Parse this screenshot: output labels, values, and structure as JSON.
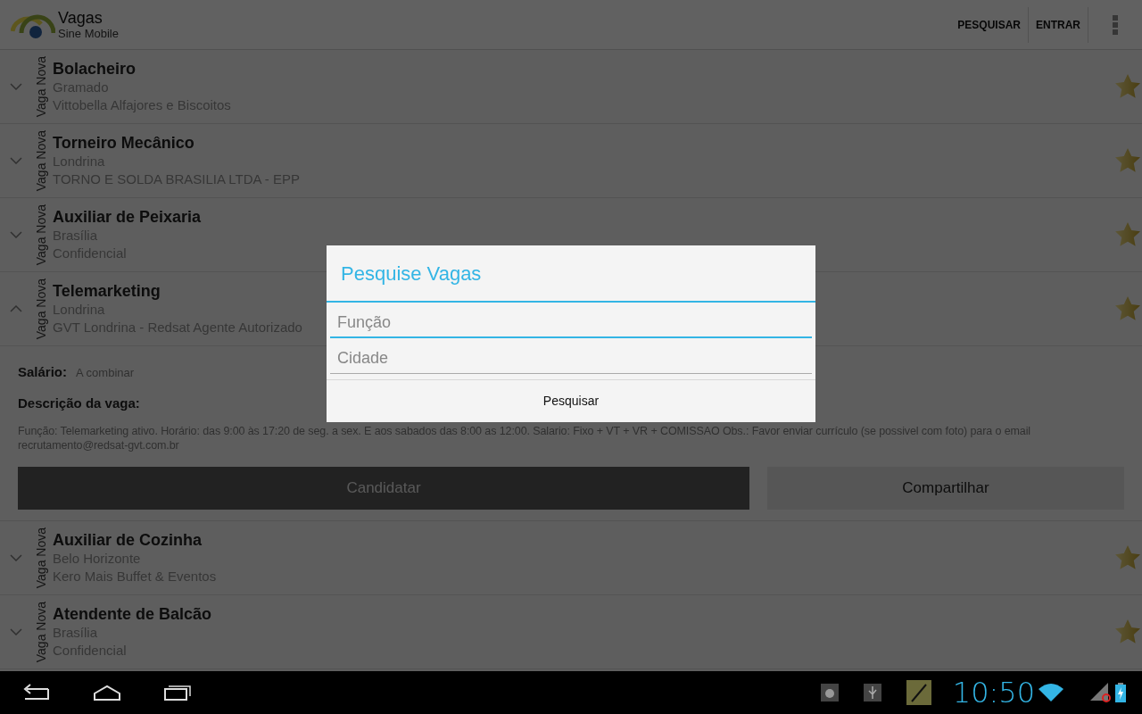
{
  "action_bar": {
    "title": "Vagas",
    "subtitle": "Sine Mobile",
    "actions": [
      "PESQUISAR",
      "ENTRAR"
    ]
  },
  "jobs": [
    {
      "badge": "Vaga Nova",
      "title": "Bolacheiro",
      "city": "Gramado",
      "company": "Vittobella Alfajores e Biscoitos",
      "expanded": false
    },
    {
      "badge": "Vaga Nova",
      "title": "Torneiro Mecânico",
      "city": "Londrina",
      "company": "TORNO E SOLDA BRASILIA LTDA - EPP",
      "expanded": false
    },
    {
      "badge": "Vaga Nova",
      "title": "Auxiliar de Peixaria",
      "city": "Brasília",
      "company": "Confidencial",
      "expanded": false
    },
    {
      "badge": "Vaga Nova",
      "title": "Telemarketing",
      "city": "Londrina",
      "company": "GVT Londrina - Redsat Agente Autorizado",
      "expanded": true,
      "details": {
        "salary_label": "Salário:",
        "salary": "A combinar",
        "description_label": "Descrição da vaga:",
        "description": "Função: Telemarketing ativo.  Horário: das 9:00 às 17:20 de seg. a sex. E aos sabados das 8:00 as 12:00.  Salario: Fixo + VT + VR + COMISSAO Obs.: Favor enviar currículo (se possivel com foto) para o email recrutamento@redsat-gvt.com.br",
        "apply": "Candidatar",
        "share": "Compartilhar"
      }
    },
    {
      "badge": "Vaga Nova",
      "title": "Auxiliar de Cozinha",
      "city": "Belo Horizonte",
      "company": "Kero Mais Buffet & Eventos",
      "expanded": false
    },
    {
      "badge": "Vaga Nova",
      "title": "Atendente de Balcão",
      "city": "Brasília",
      "company": "Confidencial",
      "expanded": false
    }
  ],
  "dialog": {
    "title": "Pesquise Vagas",
    "fields": [
      {
        "placeholder": "Função",
        "focused": true
      },
      {
        "placeholder": "Cidade",
        "focused": false
      }
    ],
    "button": "Pesquisar"
  },
  "status_bar": {
    "time": "10:50"
  }
}
